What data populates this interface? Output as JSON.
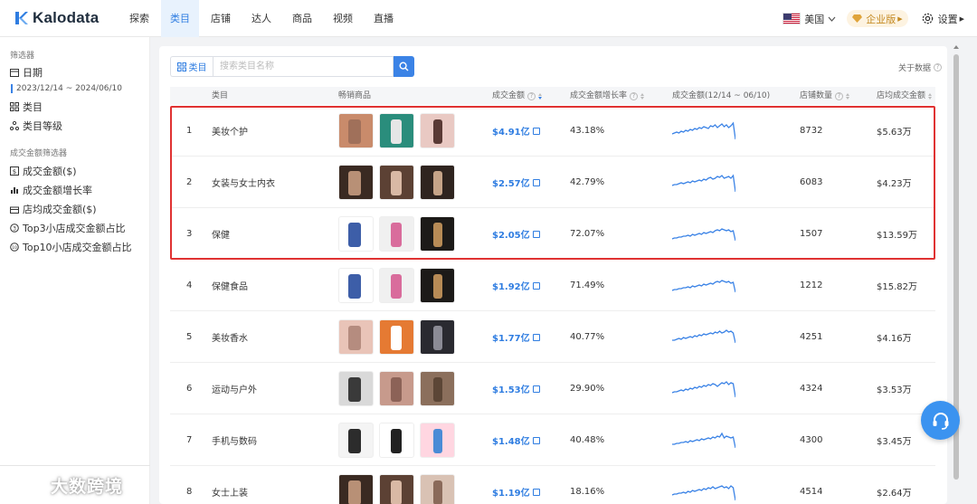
{
  "brand": {
    "name": "Kalodata",
    "accent": "#2f7de1"
  },
  "nav": {
    "items": [
      {
        "label": "探索",
        "active": false
      },
      {
        "label": "类目",
        "active": true
      },
      {
        "label": "店铺",
        "active": false
      },
      {
        "label": "达人",
        "active": false
      },
      {
        "label": "商品",
        "active": false
      },
      {
        "label": "视频",
        "active": false
      },
      {
        "label": "直播",
        "active": false
      }
    ]
  },
  "header_right": {
    "country": "美国",
    "enterprise": "企业版",
    "settings": "设置"
  },
  "sidebar": {
    "filter_title": "筛选器",
    "date_label": "日期",
    "date_range": "2023/12/14 ~ 2024/06/10",
    "category_label": "类目",
    "category_level_label": "类目等级",
    "gmv_filter_title": "成交金额筛选器",
    "gmv_items": [
      "成交金额($)",
      "成交金额增长率",
      "店均成交金额($)",
      "Top3小店成交金额占比",
      "Top10小店成交金额占比"
    ]
  },
  "watermark": "大数跨境",
  "toolbar": {
    "category_button": "类目",
    "search_placeholder": "搜索类目名称",
    "about": "关于数据"
  },
  "table": {
    "headers": {
      "category": "类目",
      "products": "畅销商品",
      "gmv": "成交金额",
      "growth": "成交金额增长率",
      "trend": "成交金额(12/14 ~ 06/10)",
      "shops": "店铺数量",
      "avg": "店均成交金额"
    },
    "rows": [
      {
        "rank": "1",
        "category": "美妆个护",
        "gmv": "$4.91亿",
        "growth": "43.18%",
        "shops": "8732",
        "avg": "$5.63万"
      },
      {
        "rank": "2",
        "category": "女装与女士内衣",
        "gmv": "$2.57亿",
        "growth": "42.79%",
        "shops": "6083",
        "avg": "$4.23万"
      },
      {
        "rank": "3",
        "category": "保健",
        "gmv": "$2.05亿",
        "growth": "72.07%",
        "shops": "1507",
        "avg": "$13.59万"
      },
      {
        "rank": "4",
        "category": "保健食品",
        "gmv": "$1.92亿",
        "growth": "71.49%",
        "shops": "1212",
        "avg": "$15.82万"
      },
      {
        "rank": "5",
        "category": "美妆香水",
        "gmv": "$1.77亿",
        "growth": "40.77%",
        "shops": "4251",
        "avg": "$4.16万"
      },
      {
        "rank": "6",
        "category": "运动与户外",
        "gmv": "$1.53亿",
        "growth": "29.90%",
        "shops": "4324",
        "avg": "$3.53万"
      },
      {
        "rank": "7",
        "category": "手机与数码",
        "gmv": "$1.48亿",
        "growth": "40.48%",
        "shops": "4300",
        "avg": "$3.45万"
      },
      {
        "rank": "8",
        "category": "女士上装",
        "gmv": "$1.19亿",
        "growth": "18.16%",
        "shops": "4514",
        "avg": "$2.64万"
      }
    ]
  },
  "colors": {
    "sparkline": "#3b83e6",
    "highlight_border": "#e03232"
  }
}
